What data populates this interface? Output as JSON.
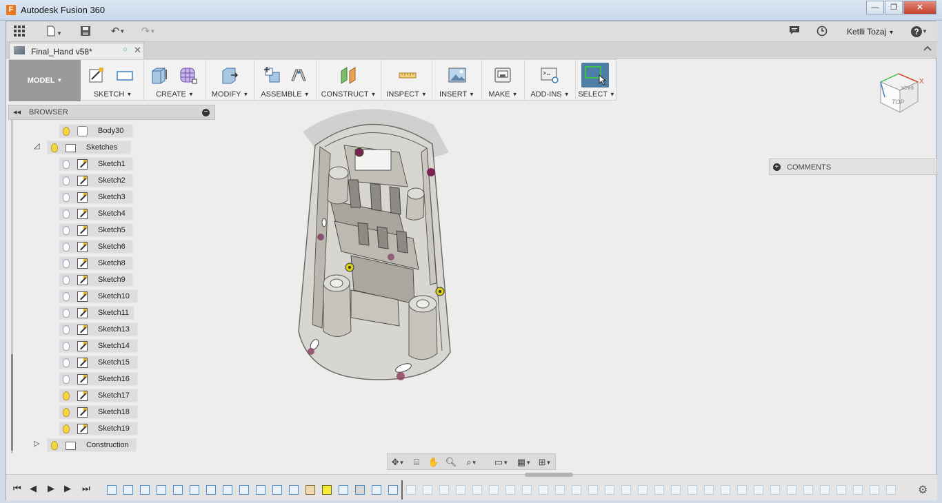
{
  "window": {
    "title": "Autodesk Fusion 360",
    "logo_letter": "F",
    "controls": [
      "—",
      "❐",
      "✕"
    ]
  },
  "appbar": {
    "user": "Ketlli Tozaj",
    "help": "?"
  },
  "document": {
    "tab_name": "Final_Hand v58*"
  },
  "toolbar": {
    "workspace": "MODEL",
    "groups": [
      "SKETCH",
      "CREATE",
      "MODIFY",
      "ASSEMBLE",
      "CONSTRUCT",
      "INSPECT",
      "INSERT",
      "MAKE",
      "ADD-INS",
      "SELECT"
    ]
  },
  "browser": {
    "title": "BROWSER",
    "items": [
      {
        "label": "Body30"
      },
      {
        "label": "Sketches"
      },
      {
        "label": "Sketch1"
      },
      {
        "label": "Sketch2"
      },
      {
        "label": "Sketch3"
      },
      {
        "label": "Sketch4"
      },
      {
        "label": "Sketch5"
      },
      {
        "label": "Sketch6"
      },
      {
        "label": "Sketch8"
      },
      {
        "label": "Sketch9"
      },
      {
        "label": "Sketch10"
      },
      {
        "label": "Sketch11"
      },
      {
        "label": "Sketch13"
      },
      {
        "label": "Sketch14"
      },
      {
        "label": "Sketch15"
      },
      {
        "label": "Sketch16"
      },
      {
        "label": "Sketch17"
      },
      {
        "label": "Sketch18"
      },
      {
        "label": "Sketch19"
      },
      {
        "label": "Construction"
      }
    ]
  },
  "viewcube": {
    "face_top": "TOP",
    "face_back": "BACK",
    "axis_x": "X"
  },
  "comments": {
    "label": "COMMENTS"
  },
  "colors": {
    "accent": "#4d7ea6",
    "timeline_highlight": "#f4ea37",
    "bulb_on": "#f3d545"
  }
}
